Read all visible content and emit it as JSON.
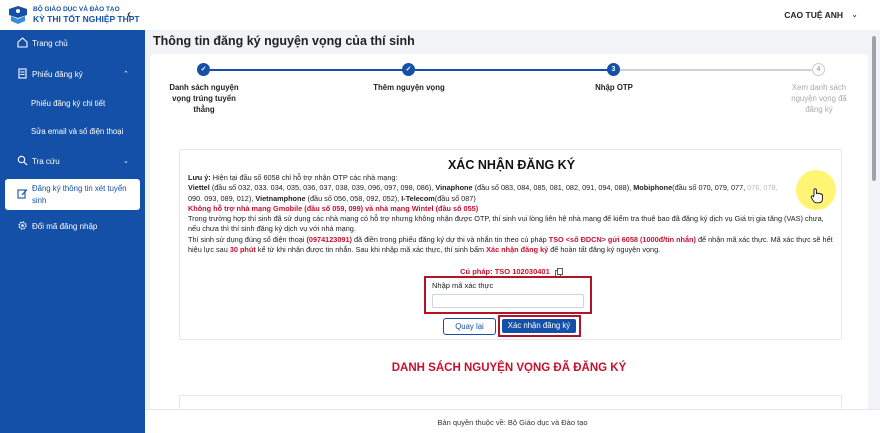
{
  "app": {
    "logo_line1": "BỘ GIÁO DỤC VÀ ĐÀO TẠO",
    "logo_line2": "KỲ THI TỐT NGHIỆP THPT"
  },
  "sidebar": {
    "home": "Trang chủ",
    "registration": "Phiếu đăng ký",
    "registration_detail": "Phiếu đăng ký chi tiết",
    "edit_contact": "Sửa email và số điện thoại",
    "lookup": "Tra cứu",
    "admission_info": "Đăng ký thông tin xét tuyển sinh",
    "change_password": "Đổi mã đăng nhập"
  },
  "header": {
    "user_name": "CAO TUỆ ANH"
  },
  "page": {
    "title": "Thông tin đăng ký nguyện vọng của thí sinh"
  },
  "stepper": {
    "steps": [
      {
        "label": "Danh sách nguyện vọng trúng tuyển thẳng",
        "state": "done",
        "marker": "✓"
      },
      {
        "label": "Thêm nguyện vọng",
        "state": "done",
        "marker": "✓"
      },
      {
        "label": "Nhập OTP",
        "state": "current",
        "marker": "3"
      },
      {
        "label": "Xem danh sách nguyện vọng đã đăng ký",
        "state": "pending",
        "marker": "4"
      }
    ]
  },
  "confirm": {
    "title": "XÁC NHẬN ĐĂNG KÝ",
    "note_label": "Lưu ý:",
    "note_text": "Hiện tại đầu số 6058 chỉ hỗ trợ nhận OTP các nhà mạng:",
    "viettel_name": "Viettel",
    "viettel_nums": "(đầu số 032, 033. 034, 035, 036, 037, 038, 039, 096, 097, 098, 086),",
    "vina_name": "Vinaphone",
    "vina_nums": "(đầu số 083, 084, 085, 081, 082, 091, 094, 088),",
    "mobi_name": "Mobiphone",
    "mobi_nums": "(đầu số 070, 079, 077,",
    "mobi_faded": "076, 078,",
    "mobi_nums2": "090. 093, 089, 012),",
    "vietnam_name": "Vietnamphone",
    "vietnam_nums": "(đầu số 056, 058, 092, 052),",
    "itel_name": "I-Telecom",
    "itel_nums": "(đầu số 087)",
    "unsupported": "Không hỗ trợ nhà mạng Gmobile (đầu số 059, 099) và nhà mạng Wintel (đầu số 055)",
    "vas_note": "Trong trường hợp thí sinh đã sử dụng các nhà mạng có hỗ trợ nhưng không nhận được OTP, thí sinh vui lòng liên hệ nhà mạng để kiểm tra thuê bao đã đăng ký dịch vụ Giá trị gia tăng (VAS) chưa, nếu chưa thì thí sinh đăng ký dịch vụ với nhà mạng.",
    "instr_1": "Thí sinh sử dụng đúng số điện thoại",
    "phone": "(0974123091)",
    "instr_2": "đã điền trong phiếu đăng ký dự thi và nhắn tin theo cú pháp",
    "sms_syntax": "TSO <số ĐDCN> gửi 6058 (1000đ/tin nhắn)",
    "instr_3": "để nhận mã xác thực. Mã xác thực sẽ hết hiệu lực sau",
    "expiry": "30 phút",
    "instr_4": "kể từ khi nhận được tin nhắn. Sau khi nhập mã xác thực, thí sinh bấm",
    "confirm_phrase": "Xác nhận đăng ký",
    "instr_5": "để hoàn tất đăng ký nguyện vọng.",
    "syntax_label": "Cú pháp: TSO 102030401",
    "otp_label": "Nhập mã xác thực",
    "otp_value": "",
    "otp_placeholder": "",
    "back_button": "Quay lại",
    "confirm_button": "Xác nhận đăng ký"
  },
  "list": {
    "title": "DANH SÁCH NGUYỆN VỌNG ĐÃ ĐĂNG KÝ"
  },
  "footer": {
    "copyright": "Bản quyền thuộc về: Bộ Giáo dục và Đào tạo"
  },
  "colors": {
    "sidebar_bg": "#1450a8",
    "accent": "#1450a8",
    "danger": "#c8102e",
    "highlight_box": "#b01426"
  },
  "icons": [
    "logo-icon",
    "home-icon",
    "document-icon",
    "search-icon",
    "edit-icon",
    "gear-icon",
    "copy-icon",
    "hand-cursor-icon"
  ]
}
